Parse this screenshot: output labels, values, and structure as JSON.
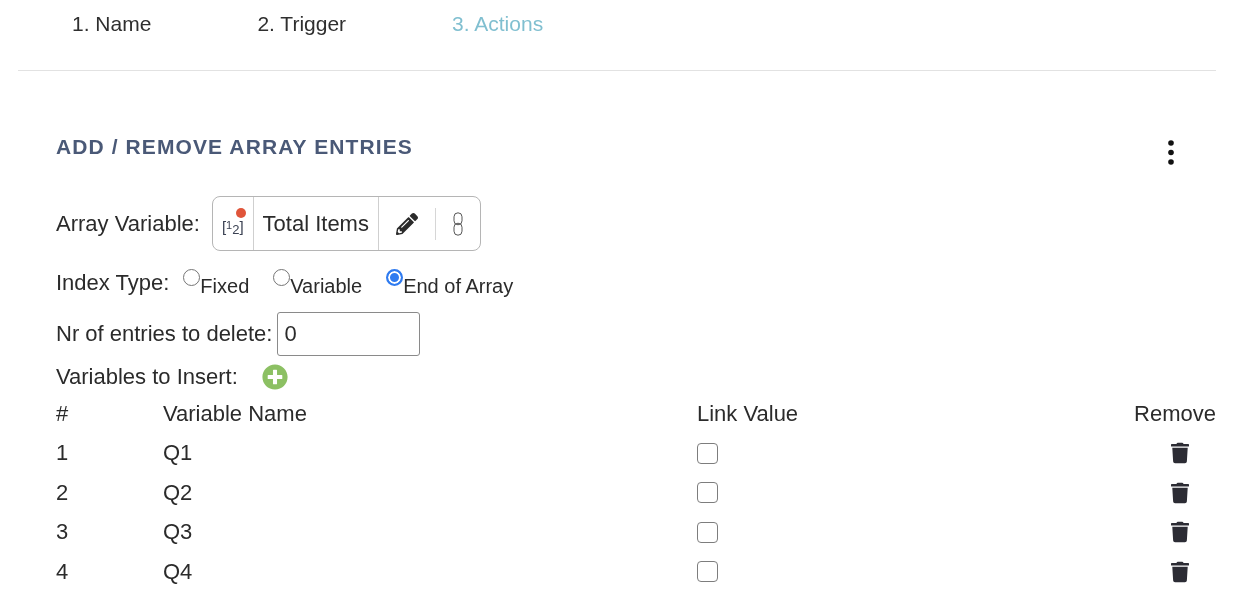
{
  "steps": [
    {
      "label": "1. Name",
      "selected": false
    },
    {
      "label": "2. Trigger",
      "selected": false
    },
    {
      "label": "3. Actions",
      "selected": true
    }
  ],
  "section": {
    "title": "ADD / REMOVE ARRAY ENTRIES"
  },
  "array_variable": {
    "label": "Array Variable:",
    "type_label": "[$^{1}$$_{2}$]",
    "value": "Total Items"
  },
  "index_type": {
    "label": "Index Type:",
    "options": [
      {
        "label": "Fixed",
        "selected": false
      },
      {
        "label": "Variable",
        "selected": false
      },
      {
        "label": "End of Array",
        "selected": true
      }
    ]
  },
  "entries_to_delete": {
    "label": "Nr of entries to delete:",
    "value": "0"
  },
  "variables_to_insert": {
    "label": "Variables to Insert:"
  },
  "table": {
    "columns": [
      "#",
      "Variable Name",
      "Link Value",
      "Remove"
    ],
    "rows": [
      {
        "number": "1",
        "name": "Q1",
        "checked": false
      },
      {
        "number": "2",
        "name": "Q2",
        "checked": false
      },
      {
        "number": "3",
        "name": "Q3",
        "checked": false
      },
      {
        "number": "4",
        "name": "Q4",
        "checked": false
      }
    ]
  }
}
